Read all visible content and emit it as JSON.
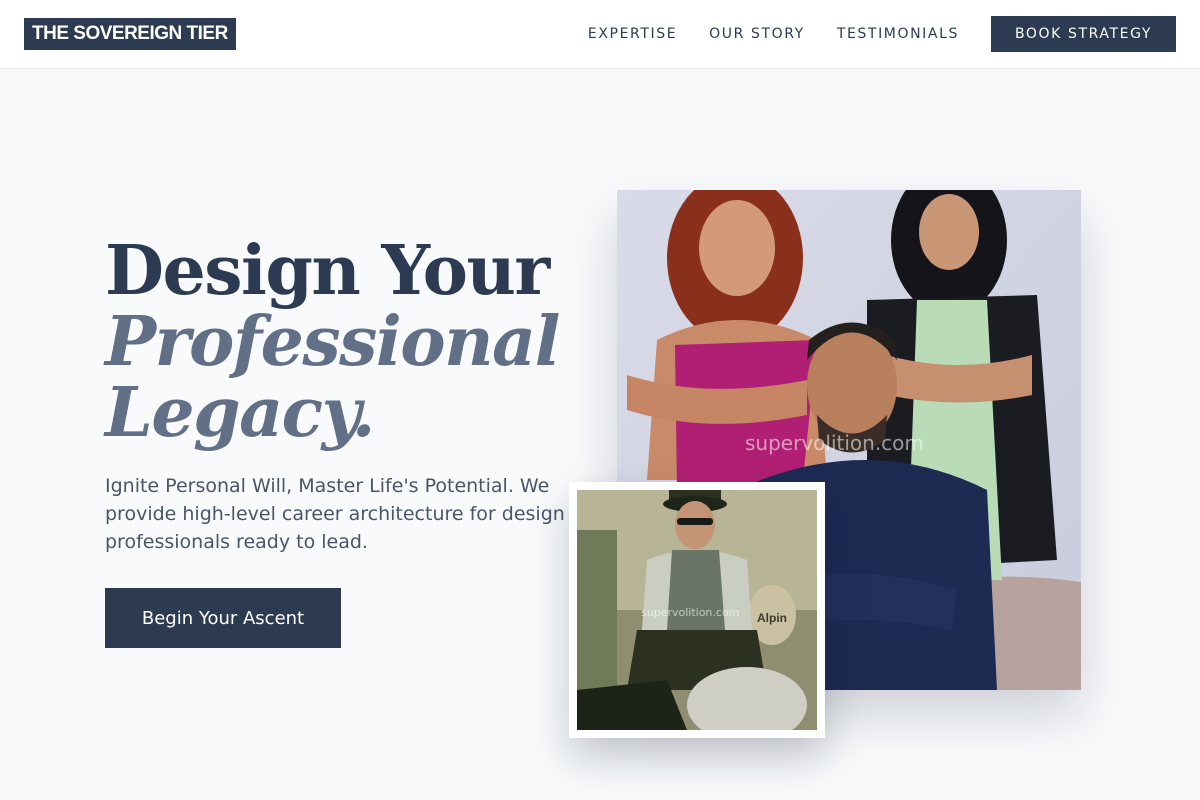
{
  "brand": {
    "logo_text": "THE SOVEREIGN TIER"
  },
  "nav": {
    "links": [
      "EXPERTISE",
      "OUR STORY",
      "TESTIMONIALS"
    ],
    "cta_label": "BOOK STRATEGY"
  },
  "hero": {
    "headline_line1": "Design Your",
    "headline_line2": "Professional",
    "headline_line3": "Legacy.",
    "subtext": "Ignite Personal Will, Master Life's Potential. We provide high-level career architecture for design professionals ready to lead.",
    "cta_label": "Begin Your Ascent"
  },
  "images": {
    "main_photo": {
      "watermark": "supervolition.com"
    },
    "inset_photo": {
      "watermark": "supervolition.com",
      "sign_text": "Alpin"
    }
  },
  "colors": {
    "primary": "#2d3b52",
    "accent_text": "#617087",
    "background": "#f8fafc",
    "body_text": "#4a5568"
  }
}
